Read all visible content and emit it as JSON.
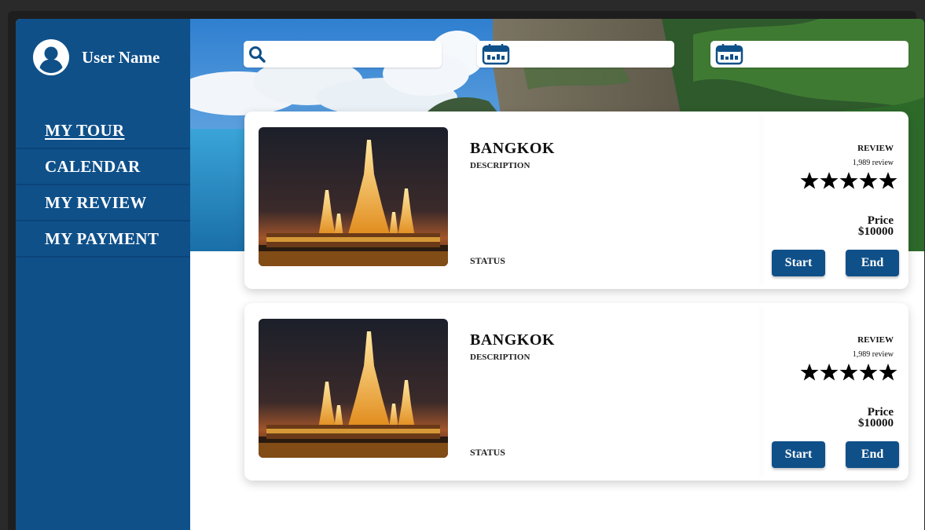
{
  "user": {
    "name": "User Name",
    "avatar_icon": "user-avatar-icon"
  },
  "nav": {
    "items": [
      {
        "label": "MY TOUR",
        "active": true
      },
      {
        "label": "CALENDAR",
        "active": false
      },
      {
        "label": "MY REVIEW",
        "active": false
      },
      {
        "label": "MY PAYMENT",
        "active": false
      }
    ]
  },
  "search": {
    "query": {
      "value": "",
      "placeholder": "",
      "icon": "search-icon"
    },
    "start_date": {
      "value": "",
      "placeholder": "",
      "icon": "calendar-icon"
    },
    "end_date": {
      "value": "",
      "placeholder": "",
      "icon": "calendar-icon"
    }
  },
  "tours": [
    {
      "title": "BANGKOK",
      "description": "DESCRIPTION",
      "status": "STATUS",
      "review_label": "REVIEW",
      "review_count": "1,989 review",
      "rating": 5,
      "price_label": "Price",
      "price": "$10000",
      "start_label": "Start",
      "end_label": "End"
    },
    {
      "title": "BANGKOK",
      "description": "DESCRIPTION",
      "status": "STATUS",
      "review_label": "REVIEW",
      "review_count": "1,989 review",
      "rating": 5,
      "price_label": "Price",
      "price": "$10000",
      "start_label": "Start",
      "end_label": "End"
    }
  ],
  "colors": {
    "sidebar": "#0f5089",
    "button": "#0f5089",
    "text": "#111111"
  }
}
